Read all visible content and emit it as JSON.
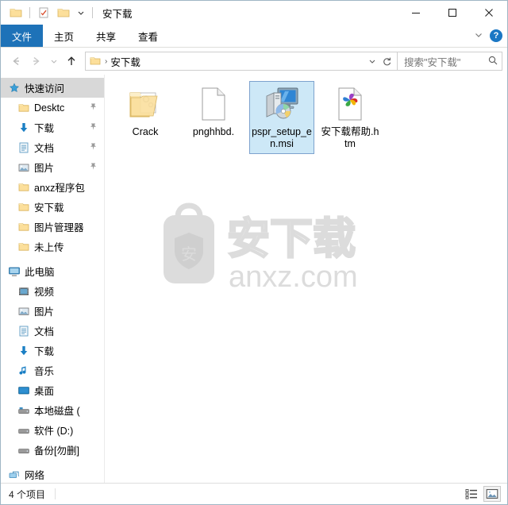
{
  "window": {
    "title": "安下载",
    "quick_access": [
      {
        "name": "folder-icon",
        "label": "属性"
      },
      {
        "name": "properties-icon",
        "label": "属性"
      },
      {
        "name": "new-folder-icon",
        "label": "新建文件夹"
      }
    ],
    "controls": {
      "minimize": "—",
      "maximize": "□",
      "close": "✕"
    }
  },
  "ribbon": {
    "tabs": [
      {
        "label": "文件",
        "active": true
      },
      {
        "label": "主页",
        "active": false
      },
      {
        "label": "共享",
        "active": false
      },
      {
        "label": "查看",
        "active": false
      }
    ],
    "expand_label": "⌄",
    "help_label": "?"
  },
  "navigation": {
    "back_label": "←",
    "forward_label": "→",
    "recent_label": "⌄",
    "up_label": "↑",
    "address": {
      "path_label": "安下载",
      "separator": "›",
      "dropdown_label": "⌄",
      "refresh_label": "↻"
    },
    "search": {
      "placeholder": "搜索\"安下载\"",
      "icon": "search-icon"
    }
  },
  "sidebar": {
    "items": [
      {
        "label": "快速访问",
        "icon": "star-icon",
        "indent": 0,
        "selected": true,
        "pinned": false
      },
      {
        "label": "Desktc",
        "icon": "folder-icon",
        "indent": 1,
        "selected": false,
        "pinned": true
      },
      {
        "label": "下载",
        "icon": "download-icon",
        "indent": 1,
        "selected": false,
        "pinned": true
      },
      {
        "label": "文档",
        "icon": "documents-icon",
        "indent": 1,
        "selected": false,
        "pinned": true
      },
      {
        "label": "图片",
        "icon": "pictures-icon",
        "indent": 1,
        "selected": false,
        "pinned": true
      },
      {
        "label": "anxz程序包",
        "icon": "folder-icon",
        "indent": 1,
        "selected": false,
        "pinned": false
      },
      {
        "label": "安下载",
        "icon": "folder-icon",
        "indent": 1,
        "selected": false,
        "pinned": false
      },
      {
        "label": "图片管理器",
        "icon": "folder-icon",
        "indent": 1,
        "selected": false,
        "pinned": false
      },
      {
        "label": "未上传",
        "icon": "folder-icon",
        "indent": 1,
        "selected": false,
        "pinned": false
      },
      {
        "label": "此电脑",
        "icon": "computer-icon",
        "indent": 0,
        "selected": false,
        "pinned": false
      },
      {
        "label": "视频",
        "icon": "videos-icon",
        "indent": 1,
        "selected": false,
        "pinned": false
      },
      {
        "label": "图片",
        "icon": "pictures-icon",
        "indent": 1,
        "selected": false,
        "pinned": false
      },
      {
        "label": "文档",
        "icon": "documents-icon",
        "indent": 1,
        "selected": false,
        "pinned": false
      },
      {
        "label": "下载",
        "icon": "download-icon",
        "indent": 1,
        "selected": false,
        "pinned": false
      },
      {
        "label": "音乐",
        "icon": "music-icon",
        "indent": 1,
        "selected": false,
        "pinned": false
      },
      {
        "label": "桌面",
        "icon": "desktop-icon",
        "indent": 1,
        "selected": false,
        "pinned": false
      },
      {
        "label": "本地磁盘 (",
        "icon": "drive-system-icon",
        "indent": 1,
        "selected": false,
        "pinned": false
      },
      {
        "label": "软件 (D:)",
        "icon": "drive-icon",
        "indent": 1,
        "selected": false,
        "pinned": false
      },
      {
        "label": "备份[勿删]",
        "icon": "drive-icon",
        "indent": 1,
        "selected": false,
        "pinned": false
      },
      {
        "label": "网络",
        "icon": "network-icon",
        "indent": 0,
        "selected": false,
        "pinned": false
      }
    ]
  },
  "files": [
    {
      "name": "Crack",
      "icon": "folder-program-icon",
      "selected": false
    },
    {
      "name": "pnghhbd.",
      "icon": "blank-document-icon",
      "selected": false
    },
    {
      "name": "pspr_setup_en.msi",
      "icon": "msi-installer-icon",
      "selected": true
    },
    {
      "name": "安下载帮助.htm",
      "icon": "html-document-icon",
      "selected": false
    }
  ],
  "watermark": {
    "text": "安下载",
    "subtext": "anxz.com",
    "badge_char": "安"
  },
  "statusbar": {
    "count_label": "4 个项目",
    "views": [
      {
        "name": "details-view-icon",
        "active": false
      },
      {
        "name": "large-icons-view-icon",
        "active": true
      }
    ]
  },
  "colors": {
    "accent": "#1e72b8",
    "selection_bg": "#cde8f7",
    "selection_border": "#7da2ce",
    "window_border": "#9fb6c4"
  }
}
